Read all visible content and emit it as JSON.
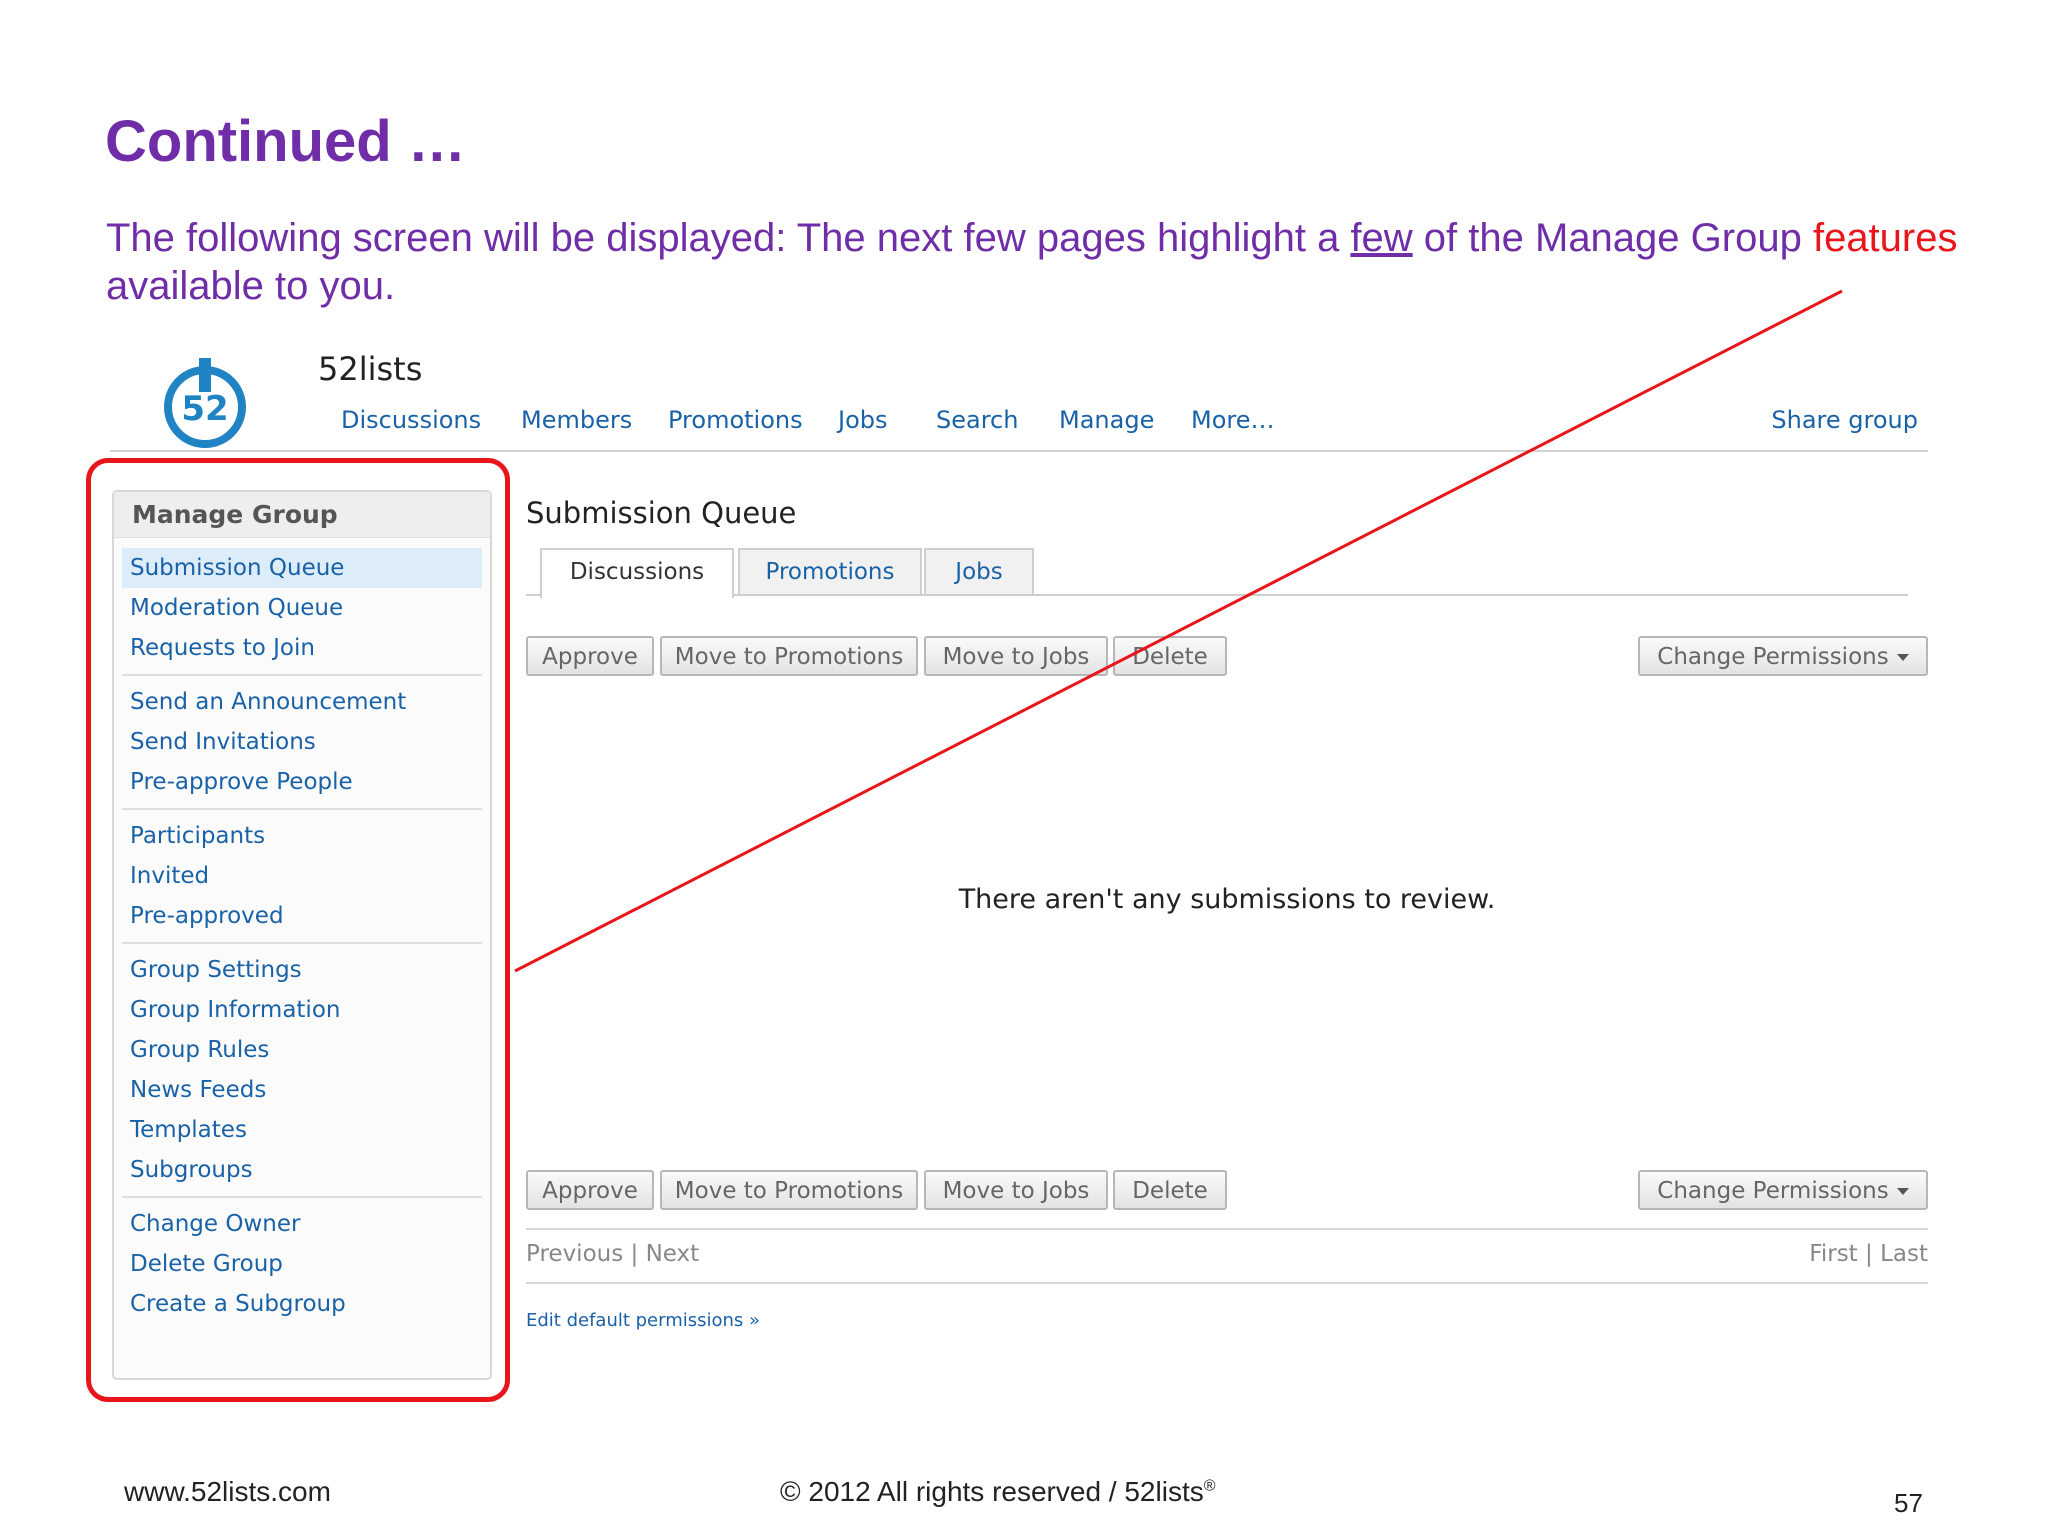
{
  "slide": {
    "title": "Continued …",
    "intro_part1": "The following screen will be displayed: The next few pages highlight a ",
    "intro_underlined": "few",
    "intro_part2": " of the Manage Group ",
    "intro_red": "features",
    "intro_part3": " available to you.",
    "footer_url": "www.52lists.com",
    "footer_copyright": "© 2012 All rights reserved / 52lists",
    "footer_reg": "®",
    "page_number": "57"
  },
  "app": {
    "logo_text": "52",
    "brand": "52lists",
    "nav": [
      "Discussions",
      "Members",
      "Promotions",
      "Jobs",
      "Search",
      "Manage",
      "More…"
    ],
    "share": "Share group"
  },
  "sidebar": {
    "header": "Manage Group",
    "groups": [
      [
        "Submission Queue",
        "Moderation Queue",
        "Requests to Join"
      ],
      [
        "Send an Announcement",
        "Send Invitations",
        "Pre-approve People"
      ],
      [
        "Participants",
        "Invited",
        "Pre-approved"
      ],
      [
        "Group Settings",
        "Group Information",
        "Group Rules",
        "News Feeds",
        "Templates",
        "Subgroups"
      ],
      [
        "Change Owner",
        "Delete Group",
        "Create a Subgroup"
      ]
    ]
  },
  "main": {
    "title": "Submission Queue",
    "tabs": [
      "Discussions",
      "Promotions",
      "Jobs"
    ],
    "actions": [
      "Approve",
      "Move to Promotions",
      "Move to Jobs",
      "Delete"
    ],
    "change_permissions": "Change Permissions",
    "empty_message": "There aren't any submissions to review.",
    "pager_prev": "Previous",
    "pager_next": "Next",
    "pager_first": "First",
    "pager_last": "Last",
    "pager_sep": "|",
    "edit_link": "Edit default permissions »"
  },
  "colors": {
    "title_purple": "#6f2da8",
    "highlight_red": "#e8151a",
    "link_blue": "#1a62a8",
    "logo_blue": "#1f83c4"
  }
}
